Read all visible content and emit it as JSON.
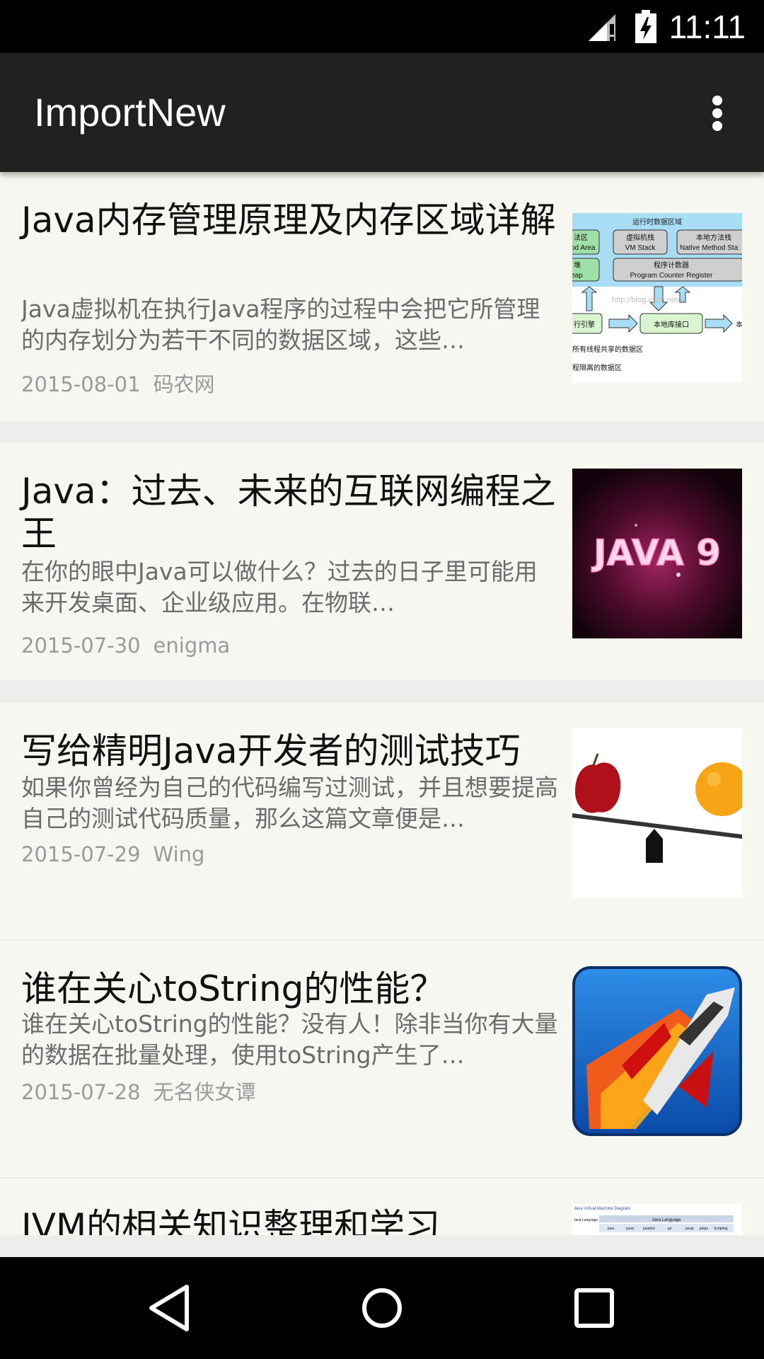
{
  "status_bar": {
    "time": "11:11"
  },
  "app_bar": {
    "title": "ImportNew"
  },
  "articles": [
    {
      "title": "Java内存管理原理及内存区域详解",
      "summary": "Java虚拟机在执行Java程序的过程中会把它所管理的内存划分为若干不同的数据区域，这些…",
      "date": "2015-08-01",
      "author": "码农网",
      "thumb": {
        "header": "运行时数据区域",
        "a": "法区",
        "a2": "od Area",
        "b": "虚拟机栈",
        "b2": "VM Stack",
        "c": "本地方法栈",
        "c2": "Native Method Sta",
        "d": "堆",
        "d2": "eap",
        "e": "程序计数器",
        "e2": "Program Counter Register",
        "url": "http://blog.csdn.net/",
        "f": "行引擎",
        "g": "本地库接口",
        "h": "本",
        "n1": "所有线程共享的数据区",
        "n2": "程隔离的数据区"
      }
    },
    {
      "title": "Java：过去、未来的互联网编程之王",
      "summary": "在你的眼中Java可以做什么？过去的日子里可能用来开发桌面、企业级应用。在物联…",
      "date": "2015-07-30",
      "author": "enigma",
      "thumb": {
        "text": "JAVA 9"
      }
    },
    {
      "title": "写给精明Java开发者的测试技巧",
      "summary": "如果你曾经为自己的代码编写过测试，并且想要提高自己的测试代码质量，那么这篇文章便是…",
      "date": "2015-07-29",
      "author": "Wing"
    },
    {
      "title": "谁在关心toString的性能？",
      "summary": "谁在关心toString的性能？没有人！除非当你有大量的数据在批量处理，使用toString产生了…",
      "date": "2015-07-28",
      "author": "无名侠女谭"
    },
    {
      "title": "JVM的相关知识整理和学习",
      "thumb": {
        "caption": "Java Virtual Machine Diagram",
        "lang": "Java Language",
        "c1": "Java Language",
        "tools": [
          "java",
          "javac",
          "javadoc",
          "jar",
          "javap",
          "jdeps",
          "Scripting"
        ]
      }
    }
  ],
  "nav": {
    "back": "back-icon",
    "home": "home-icon",
    "recents": "recents-icon"
  }
}
